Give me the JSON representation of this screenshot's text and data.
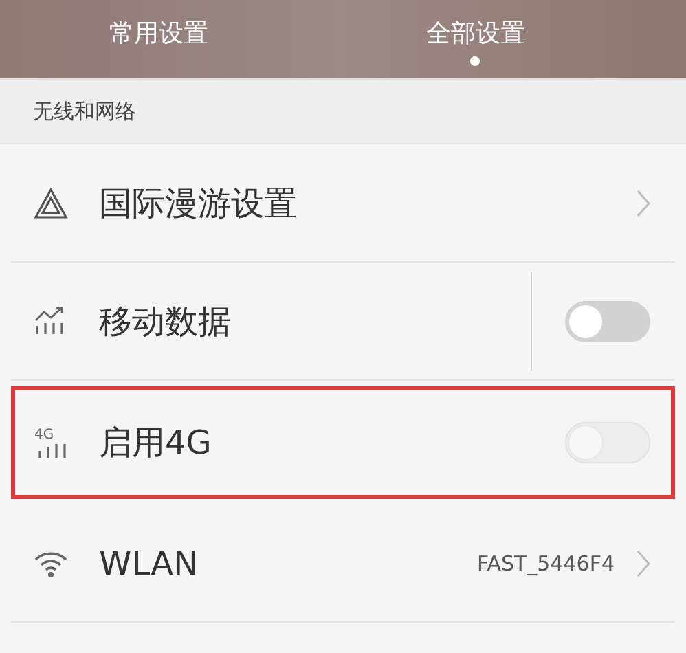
{
  "tabs": [
    {
      "label": "常用设置",
      "selected": false
    },
    {
      "label": "全部设置",
      "selected": true
    }
  ],
  "section": {
    "title": "无线和网络"
  },
  "rows": [
    {
      "kind": "chevron",
      "label": "国际漫游设置",
      "highlighted": false
    },
    {
      "kind": "toggle",
      "label": "移动数据",
      "on": false,
      "disabled": false,
      "divider": true,
      "highlighted": false
    },
    {
      "kind": "toggle",
      "icon_text": "4G",
      "label": "启用4G",
      "on": false,
      "disabled": true,
      "divider": false,
      "highlighted": true
    },
    {
      "kind": "chevron",
      "label": "WLAN",
      "value": "FAST_5446F4",
      "highlighted": false
    }
  ]
}
